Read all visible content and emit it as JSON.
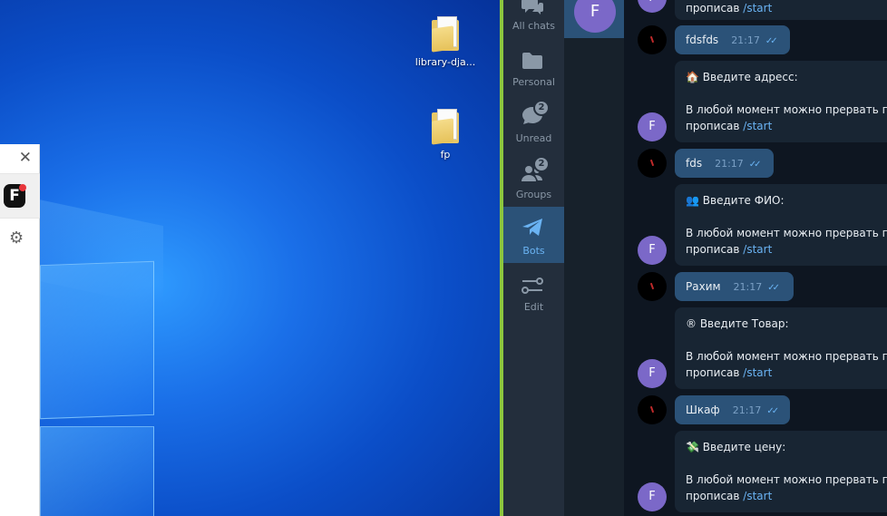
{
  "desktop": {
    "icons": [
      {
        "label": "library-dja..."
      },
      {
        "label": "fp"
      }
    ]
  },
  "mini_window": {
    "close_glyph": "✕",
    "logo_letter": "F",
    "gear_glyph": "⚙"
  },
  "telegram": {
    "folders": [
      {
        "label": "All chats",
        "icon": "chats-icon",
        "badge": ""
      },
      {
        "label": "Personal",
        "icon": "folder-icon",
        "badge": ""
      },
      {
        "label": "Unread",
        "icon": "unread-icon",
        "badge": "2"
      },
      {
        "label": "Groups",
        "icon": "groups-icon",
        "badge": "2"
      },
      {
        "label": "Bots",
        "icon": "bots-icon",
        "badge": "",
        "active": true
      },
      {
        "label": "Edit",
        "icon": "edit-icon",
        "badge": ""
      }
    ],
    "active_chat_letter": "F",
    "colors": {
      "sidebar": "#232e3c",
      "active": "#2b5278",
      "chat_bg": "#0e1621",
      "incoming": "#182533",
      "outgoing": "#2b5278",
      "link": "#6ab3f3"
    },
    "messages": [
      {
        "dir": "in",
        "line1": "прописав ",
        "link": "/start"
      },
      {
        "dir": "out",
        "text": "fdsfds",
        "time": "21:17"
      },
      {
        "dir": "in",
        "emoji": "🏠",
        "prompt": "Введите адресс:",
        "body": "В любой момент можно прервать п",
        "line2": "прописав ",
        "link": "/start"
      },
      {
        "dir": "out",
        "text": "fds",
        "time": "21:17"
      },
      {
        "dir": "in",
        "emoji": "👥",
        "prompt": "Введите ФИО:",
        "body": "В любой момент можно прервать п",
        "line2": "прописав ",
        "link": "/start"
      },
      {
        "dir": "out",
        "text": "Рахим",
        "time": "21:17"
      },
      {
        "dir": "in",
        "emoji": "®",
        "prompt": "Введите Товар:",
        "body": "В любой момент можно прервать п",
        "line2": "прописав ",
        "link": "/start"
      },
      {
        "dir": "out",
        "text": "Шкаф",
        "time": "21:17"
      },
      {
        "dir": "in",
        "emoji": "💸",
        "prompt": "Введите цену:",
        "body": "В любой момент можно прервать п",
        "line2": "прописав ",
        "link": "/start"
      }
    ],
    "bot_avatar_letter": "F"
  }
}
